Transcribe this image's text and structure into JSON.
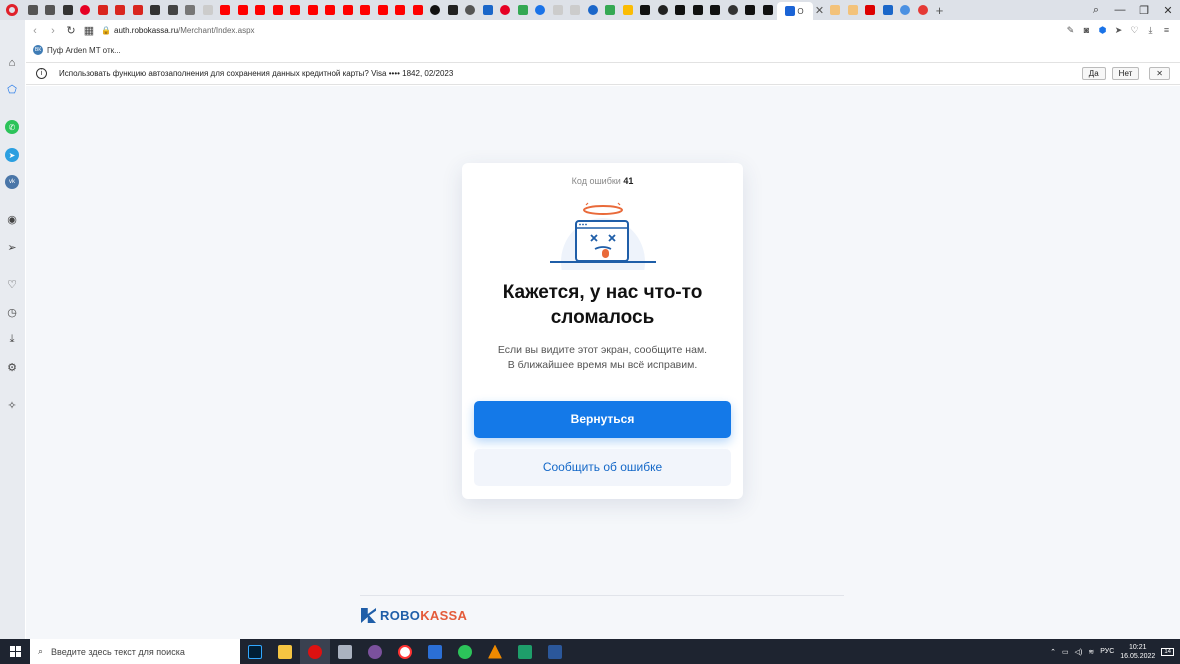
{
  "browser": {
    "active_tab_title": "O",
    "url_host": "auth.robokassa.ru",
    "url_path": "/Merchant/Index.aspx",
    "bookmark_label": "Пуф Arden MT отк..."
  },
  "autofill": {
    "message": "Использовать функцию автозаполнения для сохранения данных кредитной карты? Visa  •••• 1842, 02/2023",
    "yes_label": "Да",
    "no_label": "Нет"
  },
  "page": {
    "error_code_label": "Код ошибки",
    "error_code_value": "41",
    "title": "Кажется, у нас что-то сломалось",
    "description_line1": "Если вы видите этот экран, сообщите нам.",
    "description_line2": "В ближайшее время мы всё исправим.",
    "primary_button": "Вернуться",
    "secondary_button": "Сообщить об ошибке",
    "footer_brand_1": "ROBO",
    "footer_brand_2": "KASSA"
  },
  "taskbar": {
    "search_placeholder": "Введите здесь текст для поиска",
    "language": "РУС",
    "time": "10:21",
    "date": "16.05.2022",
    "notification_count": "14"
  },
  "colors": {
    "primary": "#1479e8",
    "brand_blue": "#1f5ea8",
    "brand_orange": "#e45b3a"
  }
}
